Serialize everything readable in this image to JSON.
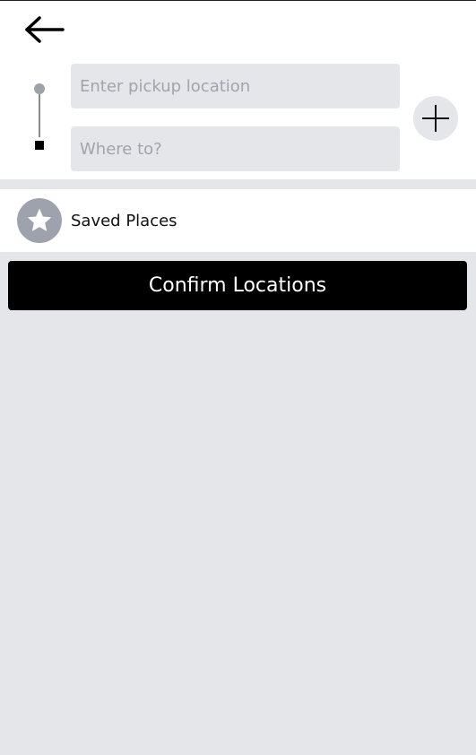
{
  "inputs": {
    "pickup_placeholder": "Enter pickup location",
    "dropoff_placeholder": "Where to?"
  },
  "saved_places": {
    "label": "Saved Places"
  },
  "confirm_button": {
    "label": "Confirm Locations"
  },
  "icons": {
    "back": "arrow-left-icon",
    "add": "plus-icon",
    "star": "star-icon",
    "route": "route-indicator-icon"
  },
  "colors": {
    "background": "#e5e6ea",
    "header": "#ffffff",
    "input_bg": "#e5e6ea",
    "placeholder": "#a1a4ad",
    "button_bg": "#000000",
    "button_text": "#ffffff",
    "star_circle": "#9ea2ad"
  }
}
